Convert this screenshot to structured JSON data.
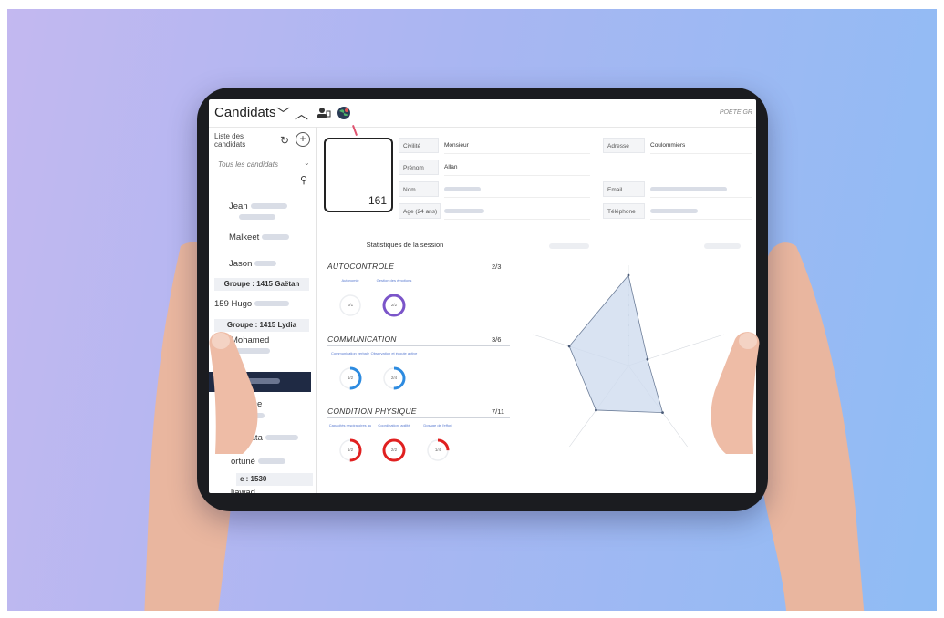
{
  "colors": {
    "background_start": "#c3b8f0",
    "background_end": "#8fbcf4",
    "selected": "#1f2a44",
    "ring_purple": "#7b55c9",
    "ring_blue": "#2d8be0",
    "ring_red": "#e02020",
    "radar_fill": "#cfdcef"
  },
  "topbar": {
    "title": "Candidats",
    "chevron_down": "﹀",
    "chevron_up": "︿",
    "right_label": "POETE GR"
  },
  "sidebar": {
    "heading": "Liste des candidats",
    "add": "+",
    "refresh": "↻",
    "filter": "Tous les candidats",
    "candidates": [
      {
        "name": "Jean"
      },
      {
        "name": "Malkeet"
      },
      {
        "name": "Jason"
      },
      {
        "name": "Hugo",
        "prefix": "159"
      },
      {
        "name": "Mohamed"
      },
      {
        "name": "llan"
      },
      {
        "name": "odnInhe"
      },
      {
        "name": "Aminata"
      },
      {
        "name": "ortuné"
      },
      {
        "name": "ljawad"
      }
    ],
    "groups": [
      "Groupe : 1415 Gaëtan",
      "Groupe : 1415 Lydia",
      "e : 1530"
    ]
  },
  "profile": {
    "number": "161",
    "fields": {
      "civilite_label": "Civilité",
      "civilite_value": "Monsieur",
      "prenom_label": "Prénom",
      "prenom_value": "Allan",
      "nom_label": "Nom",
      "age_label": "Age (24 ans)",
      "adresse_label": "Adresse",
      "adresse_value": "Coulommiers",
      "email_label": "Email",
      "telephone_label": "Téléphone"
    }
  },
  "stats": {
    "tab_active": "Statistiques de la session",
    "categories": [
      {
        "title": "AUTOCONTROLE",
        "score": "2/3",
        "skills": [
          {
            "label": "Autonomie",
            "value": "0/1",
            "fraction": 0,
            "color": "#7b55c9"
          },
          {
            "label": "Gestion des émotions",
            "value": "2/2",
            "fraction": 1,
            "color": "#7b55c9"
          }
        ]
      },
      {
        "title": "COMMUNICATION",
        "score": "3/6",
        "skills": [
          {
            "label": "Communication verbale",
            "value": "1/2",
            "fraction": 0.5,
            "color": "#2d8be0"
          },
          {
            "label": "Observation et écoute active",
            "value": "2/4",
            "fraction": 0.5,
            "color": "#2d8be0"
          }
        ]
      },
      {
        "title": "CONDITION PHYSIQUE",
        "score": "7/11",
        "skills": [
          {
            "label": "Capacités respiratoires au",
            "value": "1/2",
            "fraction": 0.5,
            "color": "#e02020"
          },
          {
            "label": "Coordination, agilité",
            "value": "2/2",
            "fraction": 1,
            "color": "#e02020"
          },
          {
            "label": "Dosage de l'effort",
            "value": "1/4",
            "fraction": 0.25,
            "color": "#e02020"
          }
        ]
      }
    ]
  },
  "radar": {
    "axes": 5,
    "levels": [
      0.9,
      0.2,
      0.58,
      0.55,
      0.62
    ]
  }
}
